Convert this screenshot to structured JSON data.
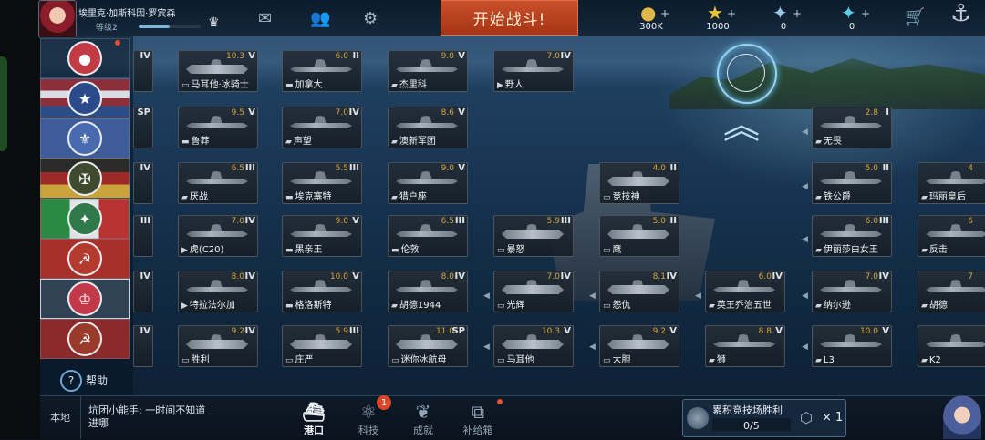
{
  "header": {
    "player_name": "埃里克·加斯科因·罗宾森",
    "level_label": "等级2",
    "xp_fraction": 0.5,
    "start_battle": "开始战斗!",
    "resources": [
      {
        "icon": "gold-coin-icon",
        "value": "300K"
      },
      {
        "icon": "star-icon",
        "value": "1000"
      },
      {
        "icon": "blue-gem-icon",
        "value": "0"
      },
      {
        "icon": "cyan-gem-icon",
        "value": "0"
      }
    ]
  },
  "sidebar": {
    "nations": [
      "japan",
      "usa",
      "france",
      "germany",
      "italy",
      "soviet",
      "uk",
      "ussr-alt"
    ],
    "active_nation": "uk",
    "help_label": "帮助"
  },
  "tree": {
    "cards": [
      {
        "name": "马耳他·冰骑士",
        "tier": "10.3",
        "cls": "V",
        "type": "carrier"
      },
      {
        "name": "加拿大",
        "tier": "6.0",
        "cls": "II",
        "type": "cruiser"
      },
      {
        "name": "杰里科",
        "tier": "9.0",
        "cls": "V",
        "type": "battleship"
      },
      {
        "name": "野人",
        "tier": "7.0",
        "cls": "IV",
        "type": "destroyer"
      },
      {
        "name": "鲁莽",
        "tier": "9.5",
        "cls": "V",
        "type": "cruiser"
      },
      {
        "name": "声望",
        "tier": "7.0",
        "cls": "IV",
        "type": "battleship"
      },
      {
        "name": "澳新军团",
        "tier": "8.6",
        "cls": "V",
        "type": "battleship"
      },
      {
        "name": "无畏",
        "tier": "2.8",
        "cls": "I",
        "type": "battleship"
      },
      {
        "name": "厌战",
        "tier": "6.5",
        "cls": "III",
        "type": "battleship"
      },
      {
        "name": "埃克塞特",
        "tier": "5.5",
        "cls": "III",
        "type": "cruiser"
      },
      {
        "name": "猎户座",
        "tier": "9.0",
        "cls": "V",
        "type": "battleship"
      },
      {
        "name": "竞技神",
        "tier": "4.0",
        "cls": "II",
        "type": "carrier"
      },
      {
        "name": "铁公爵",
        "tier": "5.0",
        "cls": "II",
        "type": "battleship"
      },
      {
        "name": "玛丽皇后",
        "tier": "4",
        "cls": "",
        "type": "battleship"
      },
      {
        "name": "虎(C20)",
        "tier": "7.0",
        "cls": "IV",
        "type": "destroyer"
      },
      {
        "name": "黑亲王",
        "tier": "9.0",
        "cls": "V",
        "type": "cruiser"
      },
      {
        "name": "伦敦",
        "tier": "6.5",
        "cls": "III",
        "type": "cruiser"
      },
      {
        "name": "暴怒",
        "tier": "5.9",
        "cls": "III",
        "type": "carrier"
      },
      {
        "name": "鹰",
        "tier": "5.0",
        "cls": "II",
        "type": "carrier"
      },
      {
        "name": "伊丽莎白女王",
        "tier": "6.0",
        "cls": "III",
        "type": "battleship"
      },
      {
        "name": "反击",
        "tier": "6",
        "cls": "",
        "type": "battleship"
      },
      {
        "name": "特拉法尔加",
        "tier": "8.0",
        "cls": "IV",
        "type": "destroyer"
      },
      {
        "name": "格洛斯特",
        "tier": "10.0",
        "cls": "V",
        "type": "cruiser"
      },
      {
        "name": "胡德1944",
        "tier": "8.0",
        "cls": "IV",
        "type": "battleship"
      },
      {
        "name": "光辉",
        "tier": "7.0",
        "cls": "IV",
        "type": "carrier"
      },
      {
        "name": "怨仇",
        "tier": "8.1",
        "cls": "IV",
        "type": "carrier"
      },
      {
        "name": "英王乔治五世",
        "tier": "6.0",
        "cls": "IV",
        "type": "battleship"
      },
      {
        "name": "纳尔逊",
        "tier": "7.0",
        "cls": "IV",
        "type": "battleship"
      },
      {
        "name": "胡德",
        "tier": "7",
        "cls": "",
        "type": "battleship"
      },
      {
        "name": "胜利",
        "tier": "9.2",
        "cls": "IV",
        "type": "carrier"
      },
      {
        "name": "庄严",
        "tier": "5.9",
        "cls": "III",
        "type": "carrier"
      },
      {
        "name": "迷你冰航母",
        "tier": "11.0",
        "cls": "SP",
        "type": "carrier"
      },
      {
        "name": "马耳他",
        "tier": "10.3",
        "cls": "V",
        "type": "carrier"
      },
      {
        "name": "大胆",
        "tier": "9.2",
        "cls": "V",
        "type": "carrier"
      },
      {
        "name": "狮",
        "tier": "8.8",
        "cls": "V",
        "type": "battleship"
      },
      {
        "name": "L3",
        "tier": "10.0",
        "cls": "V",
        "type": "battleship"
      },
      {
        "name": "K2",
        "tier": "",
        "cls": "",
        "type": "battleship"
      }
    ],
    "edge_cls": [
      "IV",
      "SP",
      "IV",
      "III",
      "IV",
      "IV"
    ]
  },
  "bottom": {
    "local_label": "本地",
    "chat_text": "坑团小能手: 一时间不知道进哪",
    "nav": [
      {
        "icon": "harbor-icon",
        "label": "港口",
        "active": true
      },
      {
        "icon": "tech-icon",
        "label": "科技",
        "badge": "1"
      },
      {
        "icon": "achievement-icon",
        "label": "成就"
      },
      {
        "icon": "supply-box-icon",
        "label": "补给箱"
      }
    ],
    "arena": {
      "title": "累积竞技场胜利",
      "progress": "0/5",
      "reward": "× 1"
    }
  },
  "colors": {
    "accent": "#c9502a",
    "tier": "#d9a63a",
    "glow": "#9ed2ef"
  }
}
